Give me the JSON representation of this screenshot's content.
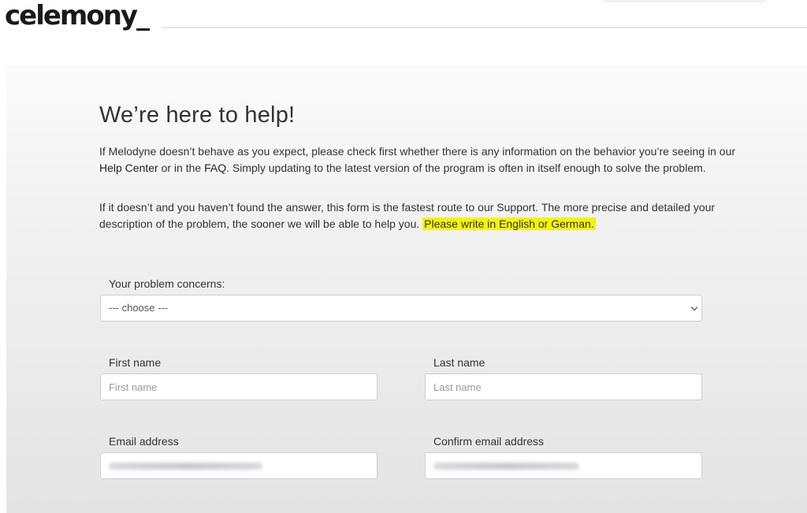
{
  "header": {
    "logo": "celemony_"
  },
  "intro": {
    "heading": "We’re here to help!",
    "p1_before_help_center": "If Melodyne doesn’t behave as you expect, please check first whether there is any information on the behavior you’re seeing in our ",
    "help_center_link": "Help Center",
    "p1_between": " or in the ",
    "faq_link": "FAQ",
    "p1_after": ". Simply updating to the latest version of the program is often in itself enough to solve the problem.",
    "p2_main": "If it doesn’t and you haven’t found the answer, this form is the fastest route to our Support. The more precise and detailed your description of the problem, the sooner we will be able to help you. ",
    "p2_highlight": "Please write in English or German.",
    "highlight_color": "#f5f500"
  },
  "form": {
    "concern_label": "Your problem concerns:",
    "concern_selected": "--- choose ---",
    "first_name_label": "First name",
    "first_name_placeholder": "First name",
    "last_name_label": "Last name",
    "last_name_placeholder": "Last name",
    "email_label": "Email address",
    "confirm_email_label": "Confirm email address"
  }
}
